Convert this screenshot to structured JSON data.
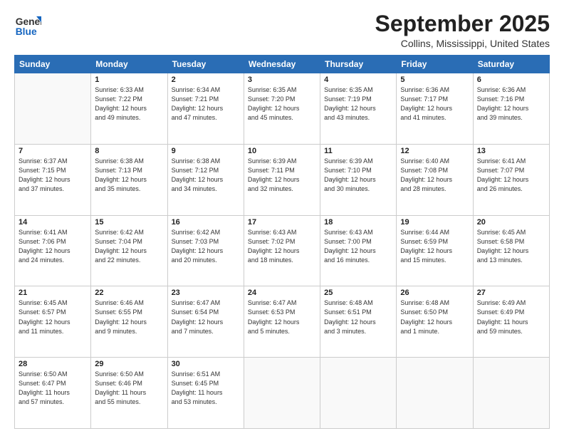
{
  "header": {
    "logo_general": "General",
    "logo_blue": "Blue",
    "month": "September 2025",
    "location": "Collins, Mississippi, United States"
  },
  "weekdays": [
    "Sunday",
    "Monday",
    "Tuesday",
    "Wednesday",
    "Thursday",
    "Friday",
    "Saturday"
  ],
  "weeks": [
    [
      {
        "day": "",
        "info": ""
      },
      {
        "day": "1",
        "info": "Sunrise: 6:33 AM\nSunset: 7:22 PM\nDaylight: 12 hours\nand 49 minutes."
      },
      {
        "day": "2",
        "info": "Sunrise: 6:34 AM\nSunset: 7:21 PM\nDaylight: 12 hours\nand 47 minutes."
      },
      {
        "day": "3",
        "info": "Sunrise: 6:35 AM\nSunset: 7:20 PM\nDaylight: 12 hours\nand 45 minutes."
      },
      {
        "day": "4",
        "info": "Sunrise: 6:35 AM\nSunset: 7:19 PM\nDaylight: 12 hours\nand 43 minutes."
      },
      {
        "day": "5",
        "info": "Sunrise: 6:36 AM\nSunset: 7:17 PM\nDaylight: 12 hours\nand 41 minutes."
      },
      {
        "day": "6",
        "info": "Sunrise: 6:36 AM\nSunset: 7:16 PM\nDaylight: 12 hours\nand 39 minutes."
      }
    ],
    [
      {
        "day": "7",
        "info": "Sunrise: 6:37 AM\nSunset: 7:15 PM\nDaylight: 12 hours\nand 37 minutes."
      },
      {
        "day": "8",
        "info": "Sunrise: 6:38 AM\nSunset: 7:13 PM\nDaylight: 12 hours\nand 35 minutes."
      },
      {
        "day": "9",
        "info": "Sunrise: 6:38 AM\nSunset: 7:12 PM\nDaylight: 12 hours\nand 34 minutes."
      },
      {
        "day": "10",
        "info": "Sunrise: 6:39 AM\nSunset: 7:11 PM\nDaylight: 12 hours\nand 32 minutes."
      },
      {
        "day": "11",
        "info": "Sunrise: 6:39 AM\nSunset: 7:10 PM\nDaylight: 12 hours\nand 30 minutes."
      },
      {
        "day": "12",
        "info": "Sunrise: 6:40 AM\nSunset: 7:08 PM\nDaylight: 12 hours\nand 28 minutes."
      },
      {
        "day": "13",
        "info": "Sunrise: 6:41 AM\nSunset: 7:07 PM\nDaylight: 12 hours\nand 26 minutes."
      }
    ],
    [
      {
        "day": "14",
        "info": "Sunrise: 6:41 AM\nSunset: 7:06 PM\nDaylight: 12 hours\nand 24 minutes."
      },
      {
        "day": "15",
        "info": "Sunrise: 6:42 AM\nSunset: 7:04 PM\nDaylight: 12 hours\nand 22 minutes."
      },
      {
        "day": "16",
        "info": "Sunrise: 6:42 AM\nSunset: 7:03 PM\nDaylight: 12 hours\nand 20 minutes."
      },
      {
        "day": "17",
        "info": "Sunrise: 6:43 AM\nSunset: 7:02 PM\nDaylight: 12 hours\nand 18 minutes."
      },
      {
        "day": "18",
        "info": "Sunrise: 6:43 AM\nSunset: 7:00 PM\nDaylight: 12 hours\nand 16 minutes."
      },
      {
        "day": "19",
        "info": "Sunrise: 6:44 AM\nSunset: 6:59 PM\nDaylight: 12 hours\nand 15 minutes."
      },
      {
        "day": "20",
        "info": "Sunrise: 6:45 AM\nSunset: 6:58 PM\nDaylight: 12 hours\nand 13 minutes."
      }
    ],
    [
      {
        "day": "21",
        "info": "Sunrise: 6:45 AM\nSunset: 6:57 PM\nDaylight: 12 hours\nand 11 minutes."
      },
      {
        "day": "22",
        "info": "Sunrise: 6:46 AM\nSunset: 6:55 PM\nDaylight: 12 hours\nand 9 minutes."
      },
      {
        "day": "23",
        "info": "Sunrise: 6:47 AM\nSunset: 6:54 PM\nDaylight: 12 hours\nand 7 minutes."
      },
      {
        "day": "24",
        "info": "Sunrise: 6:47 AM\nSunset: 6:53 PM\nDaylight: 12 hours\nand 5 minutes."
      },
      {
        "day": "25",
        "info": "Sunrise: 6:48 AM\nSunset: 6:51 PM\nDaylight: 12 hours\nand 3 minutes."
      },
      {
        "day": "26",
        "info": "Sunrise: 6:48 AM\nSunset: 6:50 PM\nDaylight: 12 hours\nand 1 minute."
      },
      {
        "day": "27",
        "info": "Sunrise: 6:49 AM\nSunset: 6:49 PM\nDaylight: 11 hours\nand 59 minutes."
      }
    ],
    [
      {
        "day": "28",
        "info": "Sunrise: 6:50 AM\nSunset: 6:47 PM\nDaylight: 11 hours\nand 57 minutes."
      },
      {
        "day": "29",
        "info": "Sunrise: 6:50 AM\nSunset: 6:46 PM\nDaylight: 11 hours\nand 55 minutes."
      },
      {
        "day": "30",
        "info": "Sunrise: 6:51 AM\nSunset: 6:45 PM\nDaylight: 11 hours\nand 53 minutes."
      },
      {
        "day": "",
        "info": ""
      },
      {
        "day": "",
        "info": ""
      },
      {
        "day": "",
        "info": ""
      },
      {
        "day": "",
        "info": ""
      }
    ]
  ]
}
